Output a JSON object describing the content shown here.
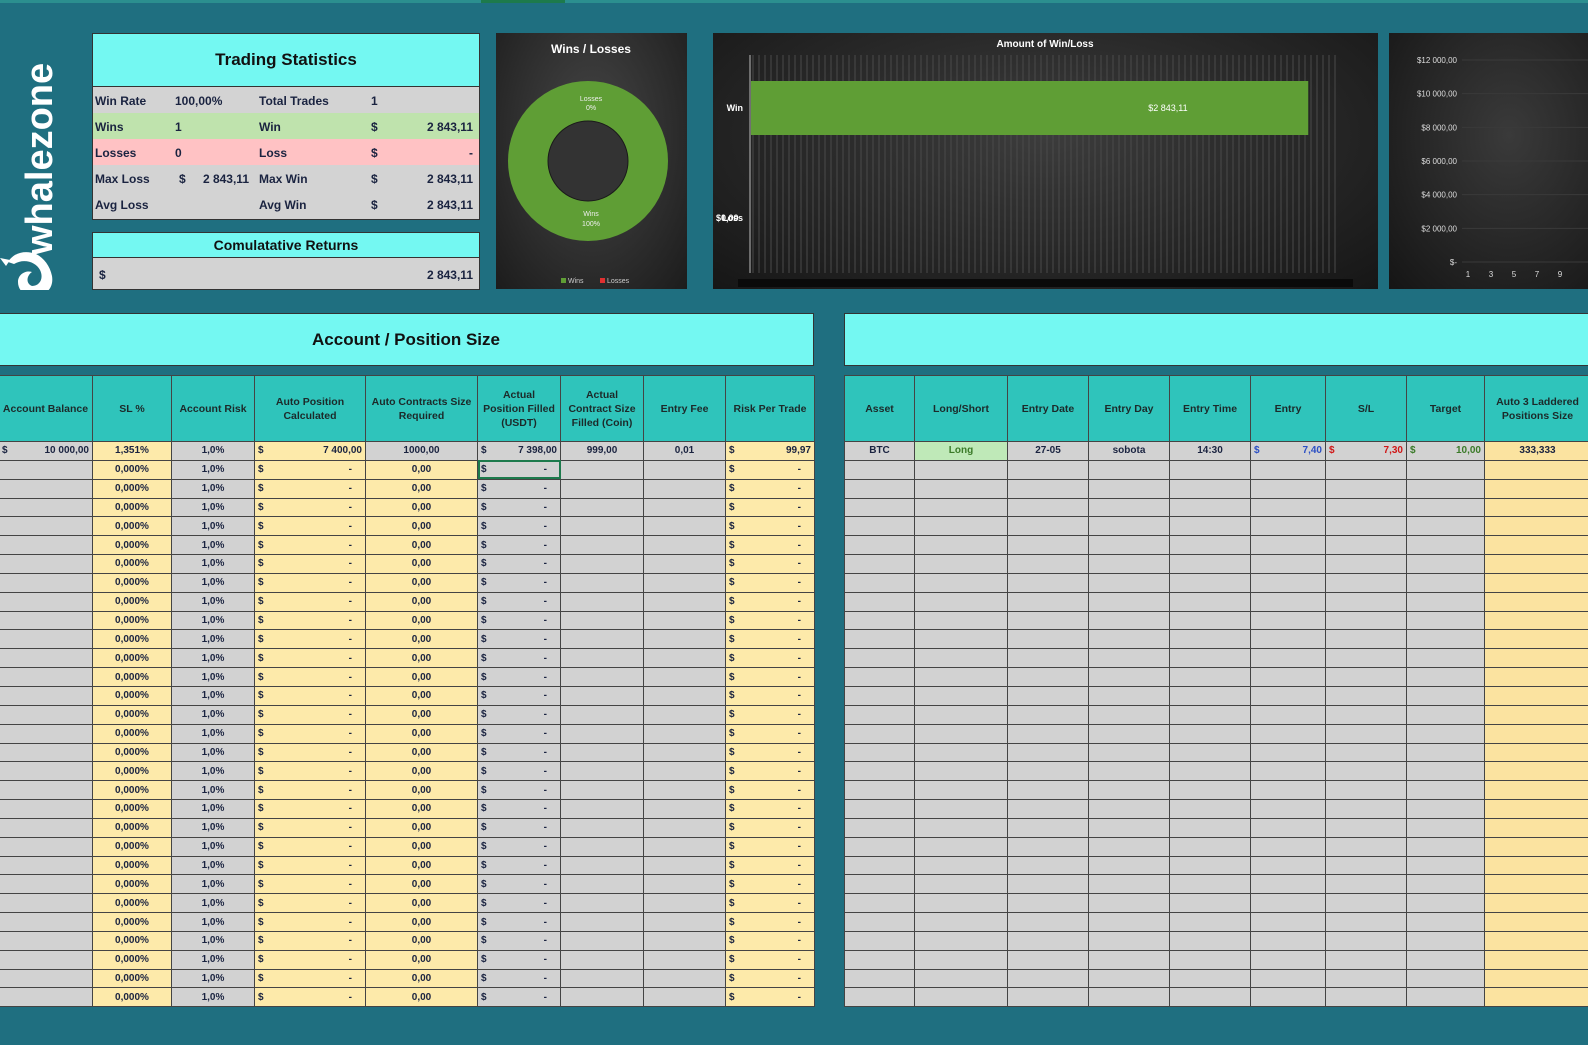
{
  "brand": {
    "name": "whalezone"
  },
  "trading_stats": {
    "title": "Trading Statistics",
    "win_rate_label": "Win Rate",
    "win_rate": "100,00%",
    "total_trades_label": "Total Trades",
    "total_trades": "1",
    "wins_label": "Wins",
    "wins": "1",
    "win_label": "Win",
    "win_value": "2 843,11",
    "losses_label": "Losses",
    "losses": "0",
    "loss_label": "Loss",
    "loss_value": "-",
    "max_loss_label": "Max Loss",
    "max_loss": "2 843,11",
    "max_win_label": "Max Win",
    "max_win": "2 843,11",
    "avg_loss_label": "Avg Loss",
    "avg_win_label": "Avg Win",
    "avg_win": "2 843,11",
    "currency": "$"
  },
  "cumulative": {
    "title": "Comulatative Returns",
    "currency": "$",
    "value": "2 843,11"
  },
  "chart_data": [
    {
      "type": "pie",
      "title": "Wins / Losses",
      "categories": [
        "Wins",
        "Losses"
      ],
      "values": [
        100,
        0
      ],
      "data_labels": [
        "Wins\n100%",
        "Losses\n0%"
      ],
      "legend": "bottom",
      "colors": [
        "#5f9e35",
        "#e03030"
      ]
    },
    {
      "type": "bar",
      "orientation": "horizontal",
      "title": "Amount of Win/Loss",
      "categories": [
        "Win",
        "Loss"
      ],
      "values": [
        2843.11,
        0
      ],
      "data_labels": [
        "$2 843,11",
        "$0,00"
      ],
      "colors": [
        "#5f9e35"
      ]
    },
    {
      "type": "line",
      "y_tick_labels": [
        "$12 000,00",
        "$10 000,00",
        "$8 000,00",
        "$6 000,00",
        "$4 000,00",
        "$2 000,00",
        "$-"
      ],
      "x_tick_labels": [
        "1",
        "3",
        "5",
        "7",
        "9"
      ],
      "ylim": [
        0,
        12000
      ]
    }
  ],
  "position_table": {
    "title": "Account / Position Size",
    "headers": [
      "Account Balance",
      "SL %",
      "Account Risk",
      "Auto Position Calculated",
      "Auto Contracts Size Required",
      "Actual Position Filled (USDT)",
      "Actual Contract Size Filled (Coin)",
      "Entry Fee",
      "Risk Per Trade"
    ],
    "currency": "$",
    "first_row": {
      "account_balance": "10 000,00",
      "sl_pct": "1,351%",
      "account_risk": "1,0%",
      "auto_position": "7 400,00",
      "auto_contracts": "1000,00",
      "actual_position": "7 398,00",
      "actual_contract": "999,00",
      "entry_fee": "0,01",
      "risk_per_trade": "99,97"
    },
    "empty_row": {
      "sl_pct": "0,000%",
      "account_risk": "1,0%",
      "dash": "-",
      "contracts": "0,00"
    },
    "empty_row_count": 29
  },
  "trade_table": {
    "title": "",
    "headers": [
      "Asset",
      "Long/Short",
      "Entry Date",
      "Entry Day",
      "Entry Time",
      "Entry",
      "S/L",
      "Target",
      "Auto 3 Laddered Positions Size"
    ],
    "currency": "$",
    "first_row": {
      "asset": "BTC",
      "side": "Long",
      "entry_date": "27-05",
      "entry_day": "sobota",
      "entry_time": "14:30",
      "entry": "7,40",
      "sl": "7,30",
      "target": "10,00",
      "laddered": "333,333"
    },
    "empty_row_count": 29
  }
}
